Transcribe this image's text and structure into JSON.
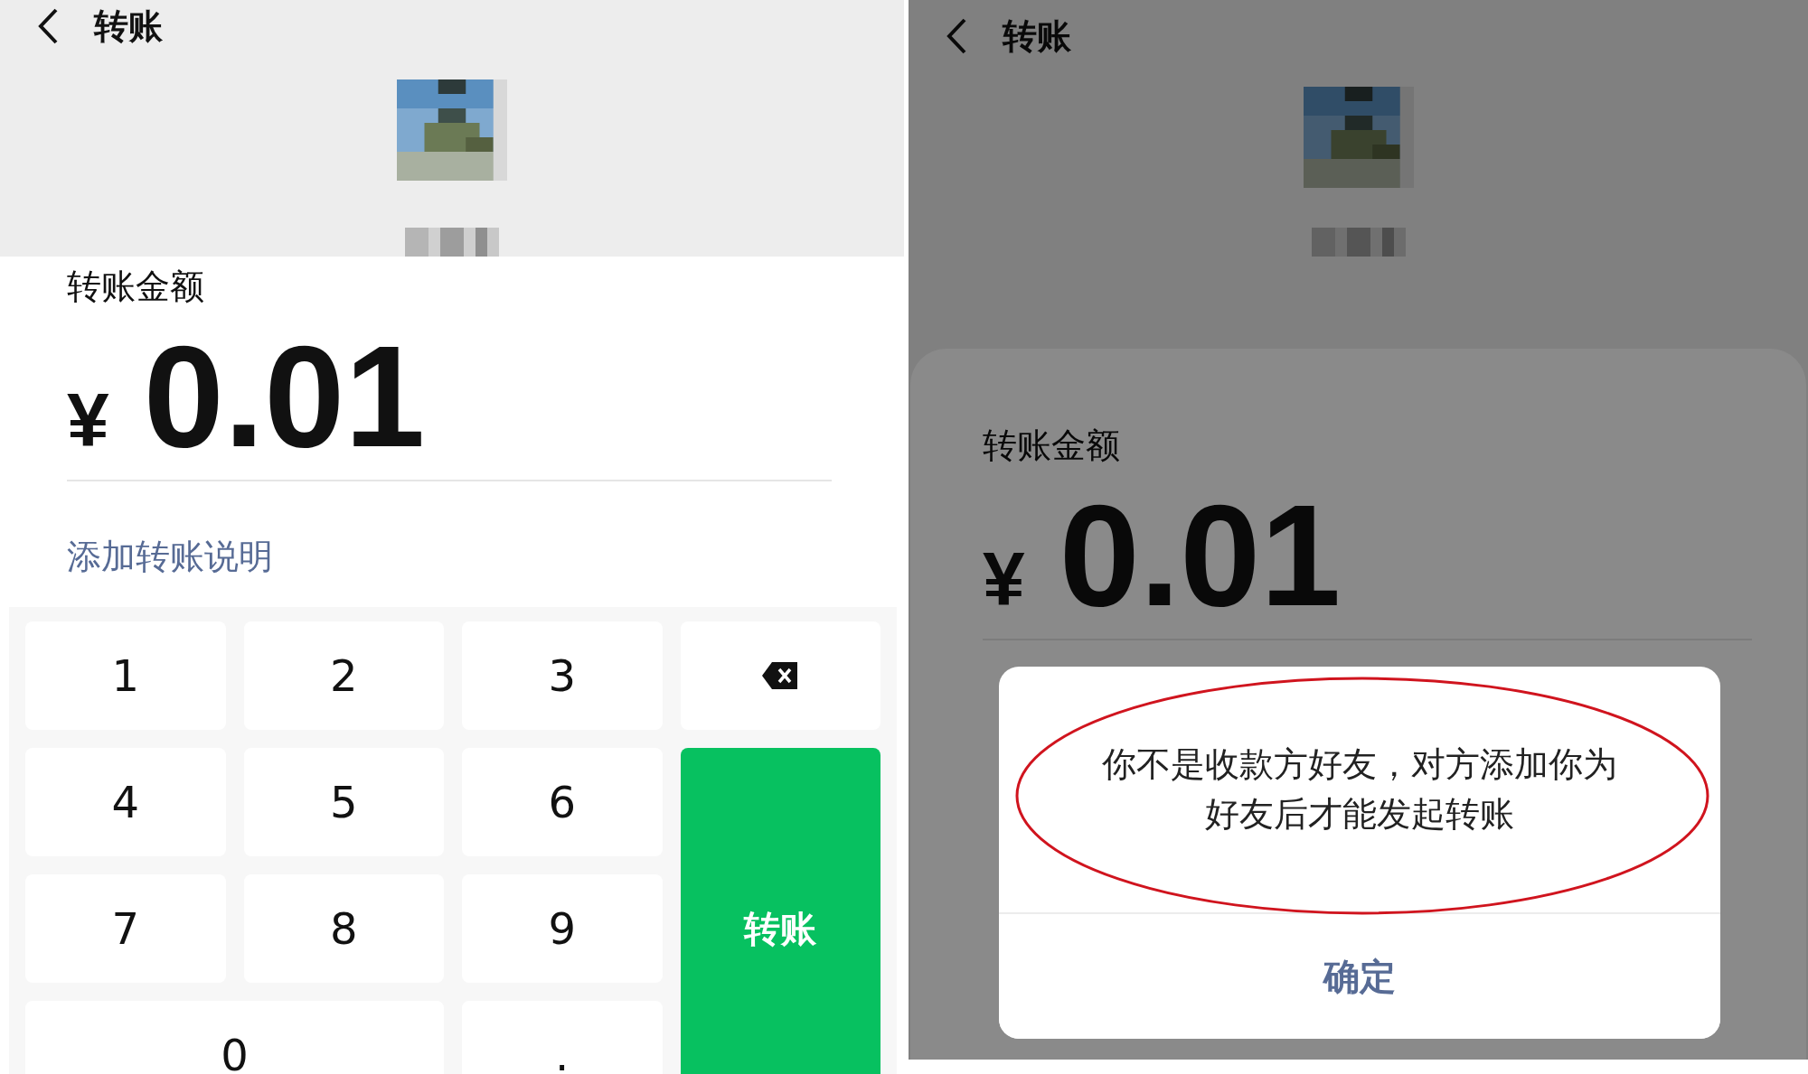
{
  "screens": [
    {
      "overlay": false,
      "title": "转账",
      "amount_label": "转账金额",
      "currency": "¥",
      "amount": "0.01",
      "note_link": "添加转账说明",
      "keys": [
        {
          "kind": "digit",
          "label": "1"
        },
        {
          "kind": "digit",
          "label": "2"
        },
        {
          "kind": "digit",
          "label": "3"
        },
        {
          "kind": "backspace"
        },
        {
          "kind": "digit",
          "label": "4"
        },
        {
          "kind": "digit",
          "label": "5"
        },
        {
          "kind": "digit",
          "label": "6"
        },
        {
          "kind": "digit",
          "label": "7"
        },
        {
          "kind": "digit",
          "label": "8"
        },
        {
          "kind": "digit",
          "label": "9"
        },
        {
          "kind": "submit",
          "label": "转账"
        },
        {
          "kind": "wide",
          "label": "0"
        },
        {
          "kind": "digit",
          "label": "."
        }
      ]
    },
    {
      "overlay": true,
      "title": "转账",
      "amount_label": "转账金额",
      "currency": "¥",
      "amount": "0.01",
      "dialog": {
        "message": "你不是收款方好友，对方添加你为好友后才能发起转账",
        "confirm": "确定"
      }
    }
  ]
}
